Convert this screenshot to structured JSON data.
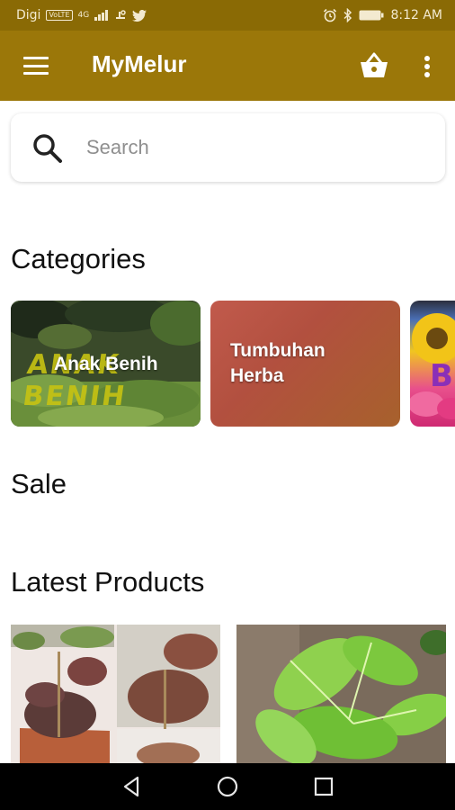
{
  "status_bar": {
    "carrier": "Digi",
    "volte": "VoLTE",
    "network": "4G",
    "time": "8:12 AM"
  },
  "app_bar": {
    "title": "MyMelur",
    "colors": {
      "status": "#8a6a05",
      "bar": "#9b7709"
    }
  },
  "search": {
    "placeholder": "Search",
    "value": ""
  },
  "sections": {
    "categories_title": "Categories",
    "sale_title": "Sale",
    "latest_title": "Latest Products"
  },
  "categories": [
    {
      "label": "Anak Benih",
      "background_text": "ANAK BENIH"
    },
    {
      "label": "Tumbuhan Herba"
    },
    {
      "label": "",
      "background_text": "BU"
    }
  ],
  "products": [
    {
      "image": "potted-red-leaf-plant-photo"
    },
    {
      "image": "green-leafy-plant-photo"
    }
  ],
  "nav": {
    "icons": [
      "back-icon",
      "home-icon",
      "recents-icon"
    ]
  }
}
